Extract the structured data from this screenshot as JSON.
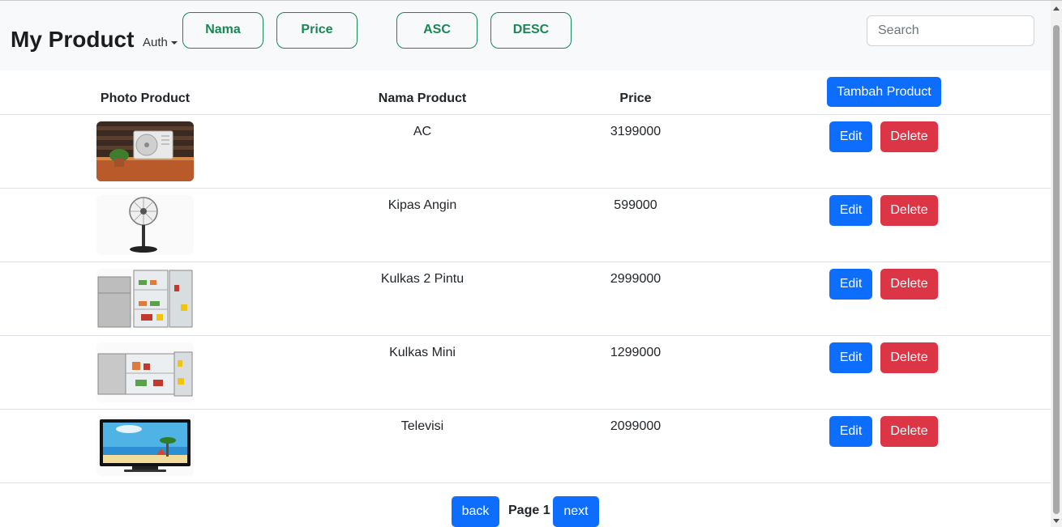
{
  "navbar": {
    "brand": "My Product",
    "auth_label": "Auth",
    "sort_buttons": [
      "Nama",
      "Price",
      "ASC",
      "DESC"
    ],
    "search_placeholder": "Search"
  },
  "table": {
    "headers": {
      "photo": "Photo Product",
      "name": "Nama Product",
      "price": "Price"
    },
    "add_label": "Tambah Product",
    "edit_label": "Edit",
    "delete_label": "Delete",
    "rows": [
      {
        "name": "AC",
        "price": "3199000",
        "image": "air-conditioner-unit-photo"
      },
      {
        "name": "Kipas Angin",
        "price": "599000",
        "image": "standing-fan-photo"
      },
      {
        "name": "Kulkas 2 Pintu",
        "price": "2999000",
        "image": "two-door-refrigerator-photo"
      },
      {
        "name": "Kulkas Mini",
        "price": "1299000",
        "image": "mini-fridge-photo"
      },
      {
        "name": "Televisi",
        "price": "2099000",
        "image": "television-photo"
      }
    ]
  },
  "pagination": {
    "back_label": "back",
    "page_label": "Page 1",
    "next_label": "next"
  },
  "colors": {
    "primary": "#0d6efd",
    "danger": "#dc3545",
    "success": "#198754",
    "navbar_bg": "#f8f9fa"
  }
}
